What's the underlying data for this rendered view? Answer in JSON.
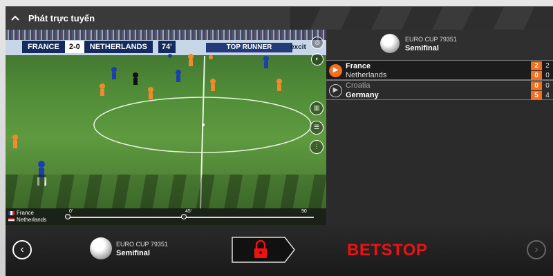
{
  "header": {
    "title": "Phát trực tuyến",
    "icon": "chevron-up-icon"
  },
  "video": {
    "scorebug": {
      "home": "FRANCE",
      "score": "2-0",
      "away": "NETHERLANDS",
      "time": "74'"
    },
    "ad_text": "TOP RUNNER",
    "ad_text2": "excit",
    "timeline": {
      "home": "France",
      "away": "Netherlands",
      "ticks": [
        "0'",
        "45'",
        "90"
      ]
    }
  },
  "panel": {
    "competition": "EURO CUP 79351",
    "round": "Semifinal",
    "matches": [
      {
        "home": "France",
        "away": "Netherlands",
        "home_score": "2",
        "away_score": "0",
        "home_score2": "2",
        "away_score2": "0",
        "live": true
      },
      {
        "home": "Croatia",
        "away": "Germany",
        "home_score": "0",
        "away_score": "5",
        "home_score2": "0",
        "away_score2": "4",
        "live": false
      }
    ]
  },
  "bottom": {
    "competition": "EURO CUP 79351",
    "round": "Semifinal",
    "status": "BETSTOP"
  },
  "colors": {
    "accent": "#f37021",
    "betstop": "#e11111",
    "panel": "#2b2b2b"
  }
}
